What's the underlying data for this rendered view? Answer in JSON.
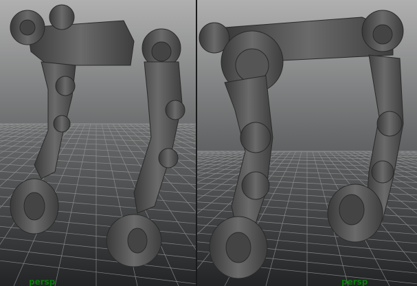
{
  "viewports": [
    {
      "camera_label": "persp"
    },
    {
      "camera_label": "persp"
    }
  ],
  "colors": {
    "background_top": "#a9a9a9",
    "background_bottom": "#262829",
    "mesh": "#5a5a5a",
    "label": "#0a7a0a"
  }
}
